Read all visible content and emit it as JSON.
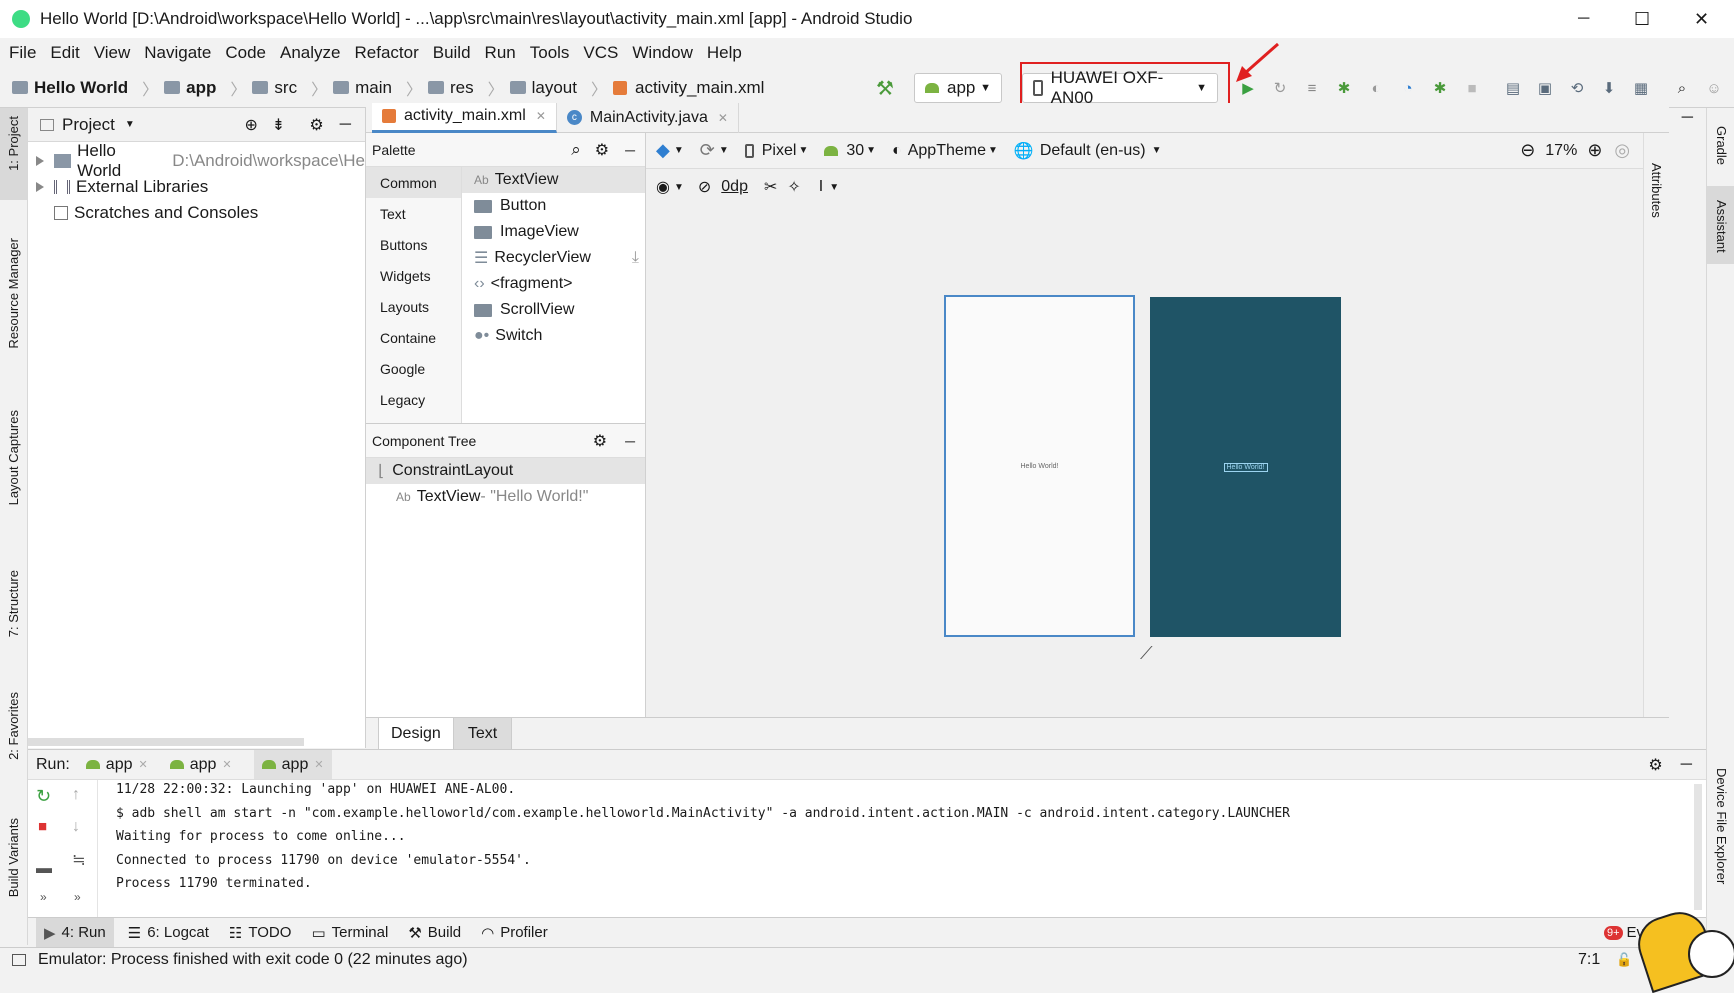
{
  "window": {
    "title": "Hello World [D:\\Android\\workspace\\Hello World] - ...\\app\\src\\main\\res\\layout\\activity_main.xml [app] - Android Studio",
    "min": "─",
    "max": "☐",
    "close": "✕"
  },
  "menu": [
    "File",
    "Edit",
    "View",
    "Navigate",
    "Code",
    "Analyze",
    "Refactor",
    "Build",
    "Run",
    "Tools",
    "VCS",
    "Window",
    "Help"
  ],
  "breadcrumb": [
    "Hello World",
    "app",
    "src",
    "main",
    "res",
    "layout",
    "activity_main.xml"
  ],
  "toolbar": {
    "config": "app",
    "device": "HUAWEI OXF-AN00"
  },
  "project": {
    "header": "Project",
    "items": [
      {
        "label": "Hello World",
        "path": "D:\\Android\\workspace\\He"
      },
      {
        "label": "External Libraries",
        "path": ""
      },
      {
        "label": "Scratches and Consoles",
        "path": ""
      }
    ]
  },
  "editor_tabs": [
    "activity_main.xml",
    "MainActivity.java"
  ],
  "palette": {
    "title": "Palette",
    "categories": [
      "Common",
      "Text",
      "Buttons",
      "Widgets",
      "Layouts",
      "Containe",
      "Google",
      "Legacy"
    ],
    "items": [
      "TextView",
      "Button",
      "ImageView",
      "RecyclerView",
      "<fragment>",
      "ScrollView",
      "Switch"
    ]
  },
  "design_toolbar": {
    "device": "Pixel",
    "api": "30",
    "theme": "AppTheme",
    "locale": "Default (en-us)",
    "zoom": "17%",
    "margin": "0dp"
  },
  "component_tree": {
    "title": "Component Tree",
    "root": "ConstraintLayout",
    "child": "TextView",
    "child_text": "- \"Hello World!\""
  },
  "preview_text": "Hello World!",
  "blueprint_text": "Hello World!",
  "design_tabs": [
    "Design",
    "Text"
  ],
  "run": {
    "label": "Run:",
    "tabs": [
      "app",
      "app",
      "app"
    ],
    "lines": [
      "11/28 22:00:32: Launching 'app' on HUAWEI ANE-AL00.",
      "$ adb shell am start -n \"com.example.helloworld/com.example.helloworld.MainActivity\" -a android.intent.action.MAIN -c android.intent.category.LAUNCHER",
      "Waiting for process to come online...",
      "Connected to process 11790 on device 'emulator-5554'.",
      "Process 11790 terminated."
    ]
  },
  "tool_windows": [
    "4: Run",
    "6: Logcat",
    "TODO",
    "Terminal",
    "Build",
    "Profiler"
  ],
  "event_log": "Even",
  "event_badge": "9+",
  "status": {
    "message": "Emulator: Process finished with exit code 0 (22 minutes ago)",
    "position": "7:1"
  },
  "side_left": [
    "1: Project",
    "Resource Manager",
    "Layout Captures",
    "7: Structure",
    "2: Favorites",
    "Build Variants"
  ],
  "side_right": [
    "Gradle",
    "Assistant",
    "Attributes",
    "Device File Explorer"
  ],
  "colors": {
    "accent": "#2f7fd1",
    "blueprint": "#1f5466",
    "red": "#e02020",
    "run_green": "#3aa040"
  }
}
